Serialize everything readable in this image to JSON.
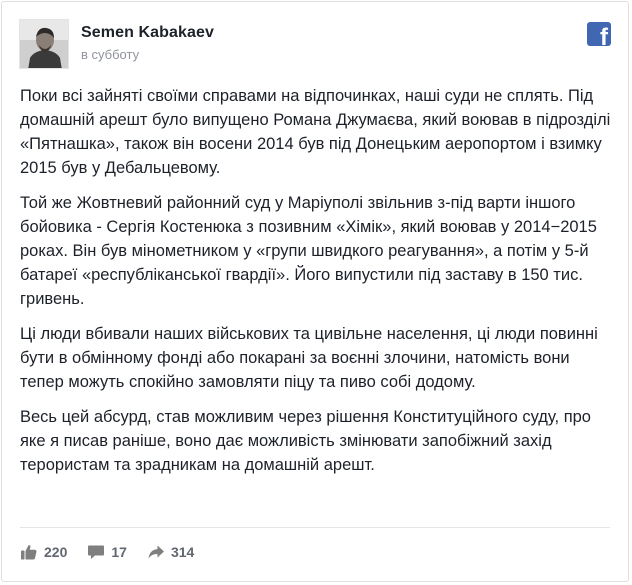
{
  "post": {
    "author": "Semen Kabakaev",
    "date": "в субботу",
    "paragraphs": [
      "Поки всі зайняті своїми справами на відпочинках, наші суди не сплять. Під домашній арешт було випущено Романа Джумаєва, який воював в підрозділі «Пятнашка», також він восени 2014 був під Донецьким аеропортом і взимку 2015 був у Дебальцевому.",
      "Той же Жовтневий районний суд у Маріуполі звільнив з-під варти іншого бойовика - Сергія Костенюка з позивним «Хімік», який воював у 2014−2015 роках. Він був мінометником у «групи швидкого реагування», а потім у 5-й батареї «республіканської гвардії». Його випустили під заставу в 150 тис. гривень.",
      "Ці люди вбивали наших військових та цивільне населення, ці люди повинні бути в обмінному фонді або покарані за воєнні злочини, натомість вони тепер можуть спокійно замовляти піцу та пиво собі додому.",
      "Весь цей абсурд, став можливим через рішення Конституційного суду, про яке я писав раніше, воно дає можливість змінювати запобіжний захід терористам та зрадникам на домашній арешт."
    ]
  },
  "stats": {
    "likes": "220",
    "comments": "17",
    "shares": "314"
  },
  "icons": {
    "brand": "facebook-icon",
    "like": "thumbs-up-icon",
    "comment": "comment-icon",
    "share": "share-arrow-icon"
  },
  "colors": {
    "facebook_blue": "#4267b2",
    "text": "#1d2129",
    "muted": "#90949c",
    "stat": "#616770"
  }
}
